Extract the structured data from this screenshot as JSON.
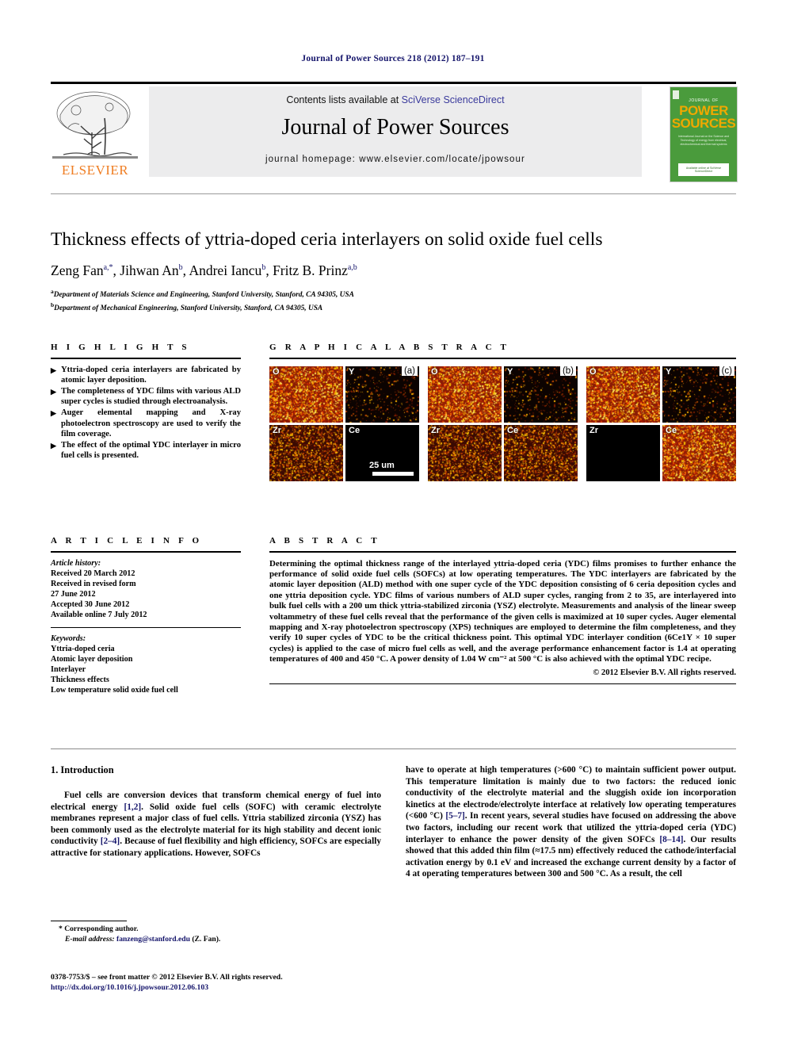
{
  "running_head": "Journal of Power Sources 218 (2012) 187–191",
  "masthead": {
    "publisher_name": "ELSEVIER",
    "contents_prefix": "Contents lists available at ",
    "contents_link": "SciVerse ScienceDirect",
    "journal_title": "Journal of Power Sources",
    "homepage": "journal homepage: www.elsevier.com/locate/jpowsour",
    "cover": {
      "kicker": "JOURNAL OF",
      "line1": "POWER",
      "line2": "SOURCES",
      "subtitle": "International Journal on the Science and Technology of energy from electrical, electrochemical and thermal systems",
      "footer": "Available online at\nSciVerse ScienceDirect",
      "bg_color": "#4a9b3c"
    }
  },
  "article": {
    "title": "Thickness effects of yttria-doped ceria interlayers on solid oxide fuel cells",
    "authors": [
      {
        "name": "Zeng Fan",
        "marks": "a,*"
      },
      {
        "name": "Jihwan An",
        "marks": "b"
      },
      {
        "name": "Andrei Iancu",
        "marks": "b"
      },
      {
        "name": "Fritz B. Prinz",
        "marks": "a,b"
      }
    ],
    "affiliations": [
      {
        "mark": "a",
        "text": "Department of Materials Science and Engineering, Stanford University, Stanford, CA 94305, USA"
      },
      {
        "mark": "b",
        "text": "Department of Mechanical Engineering, Stanford University, Stanford, CA 94305, USA"
      }
    ]
  },
  "highlights": {
    "heading": "H I G H L I G H T S",
    "bullet_glyph": "▶",
    "items": [
      "Yttria-doped ceria interlayers are fabricated by atomic layer deposition.",
      "The completeness of YDC films with various ALD super cycles is studied through electroanalysis.",
      "Auger elemental mapping and X-ray photoelectron spectroscopy are used to verify the film coverage.",
      "The effect of the optimal YDC interlayer in micro fuel cells is presented."
    ]
  },
  "graphical_abstract": {
    "heading": "G R A P H I C A L   A B S T R A C T",
    "panels": [
      {
        "tag": "(a)",
        "cells": [
          {
            "label": "O",
            "style": "bright"
          },
          {
            "label": "Y",
            "style": "dark"
          },
          {
            "label": "Zr",
            "style": "medium"
          },
          {
            "label": "Ce",
            "style": "black"
          }
        ]
      },
      {
        "tag": "(b)",
        "cells": [
          {
            "label": "O",
            "style": "bright"
          },
          {
            "label": "Y",
            "style": "dark"
          },
          {
            "label": "Zr",
            "style": "medium"
          },
          {
            "label": "Ce",
            "style": "medium"
          }
        ]
      },
      {
        "tag": "(c)",
        "cells": [
          {
            "label": "O",
            "style": "bright"
          },
          {
            "label": "Y",
            "style": "dark"
          },
          {
            "label": "Zr",
            "style": "black"
          },
          {
            "label": "Ce",
            "style": "bright"
          }
        ]
      }
    ],
    "scale_bar_label": "25 um"
  },
  "article_info": {
    "heading": "A R T I C L E   I N F O",
    "history_label": "Article history:",
    "history": [
      "Received 20 March 2012",
      "Received in revised form",
      "27 June 2012",
      "Accepted 30 June 2012",
      "Available online 7 July 2012"
    ],
    "keywords_label": "Keywords:",
    "keywords": [
      "Yttria-doped ceria",
      "Atomic layer deposition",
      "Interlayer",
      "Thickness effects",
      "Low temperature solid oxide fuel cell"
    ]
  },
  "abstract": {
    "heading": "A B S T R A C T",
    "text": "Determining the optimal thickness range of the interlayed yttria-doped ceria (YDC) films promises to further enhance the performance of solid oxide fuel cells (SOFCs) at low operating temperatures. The YDC interlayers are fabricated by the atomic layer deposition (ALD) method with one super cycle of the YDC deposition consisting of 6 ceria deposition cycles and one yttria deposition cycle. YDC films of various numbers of ALD super cycles, ranging from 2 to 35, are interlayered into bulk fuel cells with a 200 um thick yttria-stabilized zirconia (YSZ) electrolyte. Measurements and analysis of the linear sweep voltammetry of these fuel cells reveal that the performance of the given cells is maximized at 10 super cycles. Auger elemental mapping and X-ray photoelectron spectroscopy (XPS) techniques are employed to determine the film completeness, and they verify 10 super cycles of YDC to be the critical thickness point. This optimal YDC interlayer condition (6Ce1Y × 10 super cycles) is applied to the case of micro fuel cells as well, and the average performance enhancement factor is 1.4 at operating temperatures of 400 and 450 °C. A power density of 1.04 W cm⁻² at 500 °C is also achieved with the optimal YDC recipe.",
    "copyright": "© 2012 Elsevier B.V. All rights reserved."
  },
  "body": {
    "section_number_title": "1.  Introduction",
    "left_paragraph_parts": [
      "Fuel cells are conversion devices that transform chemical energy of fuel into electrical energy ",
      "[1,2]",
      ". Solid oxide fuel cells (SOFC) with ceramic electrolyte membranes represent a major class of fuel cells. Yttria stabilized zirconia (YSZ) has been commonly used as the electrolyte material for its high stability and decent ionic conductivity ",
      "[2–4]",
      ". Because of fuel flexibility and high efficiency, SOFCs are especially attractive for stationary applications. However, SOFCs"
    ],
    "right_paragraph_parts": [
      "have to operate at high temperatures (>600 °C) to maintain sufficient power output. This temperature limitation is mainly due to two factors: the reduced ionic conductivity of the electrolyte material and the sluggish oxide ion incorporation kinetics at the electrode/electrolyte interface at relatively low operating temperatures (<600 °C) ",
      "[5–7]",
      ". In recent years, several studies have focused on addressing the above two factors, including our recent work that utilized the yttria-doped ceria (YDC) interlayer to enhance the power density of the given SOFCs ",
      "[8–14]",
      ". Our results showed that this added thin film (≈17.5 nm) effectively reduced the cathode/interfacial activation energy by 0.1 eV and increased the exchange current density by a factor of 4 at operating temperatures between 300 and 500 °C. As a result, the cell"
    ]
  },
  "footer": {
    "corresponding_author": "* Corresponding author.",
    "email_label": "E-mail address:",
    "email": "fanzeng@stanford.edu",
    "email_suffix": "(Z. Fan).",
    "issn_line": "0378-7753/$ – see front matter © 2012 Elsevier B.V. All rights reserved.",
    "doi": "http://dx.doi.org/10.1016/j.jpowsour.2012.06.103"
  },
  "colors": {
    "link_blue": "#15156b",
    "sciencedirect_blue": "#3a3a9c",
    "elsevier_orange": "#ef7d22",
    "banner_gray": "#ececed"
  }
}
